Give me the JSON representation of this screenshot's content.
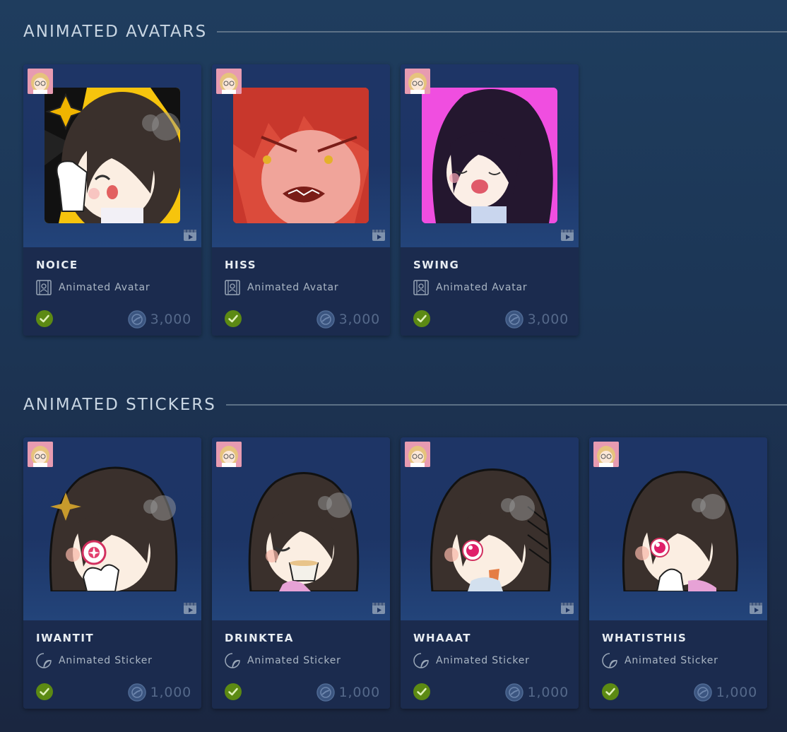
{
  "sections": [
    {
      "title": "ANIMATED AVATARS",
      "items": [
        {
          "name": "NOICE",
          "type": "Animated Avatar",
          "price": "3,000",
          "bg": "#f6c40d"
        },
        {
          "name": "HISS",
          "type": "Animated Avatar",
          "price": "3,000",
          "bg": "#d94a3a"
        },
        {
          "name": "SWING",
          "type": "Animated Avatar",
          "price": "3,000",
          "bg": "#f04ee0"
        }
      ]
    },
    {
      "title": "ANIMATED STICKERS",
      "items": [
        {
          "name": "IWANTIT",
          "type": "Animated Sticker",
          "price": "1,000"
        },
        {
          "name": "DRINKTEA",
          "type": "Animated Sticker",
          "price": "1,000"
        },
        {
          "name": "WHAAAT",
          "type": "Animated Sticker",
          "price": "1,000"
        },
        {
          "name": "WHATISTHIS",
          "type": "Animated Sticker",
          "price": "1,000"
        }
      ]
    }
  ],
  "colors": {
    "owned_check": "#5c8a13",
    "price_text": "#55698a",
    "card_bg": "#1f3563"
  },
  "icons": {
    "avatar_type": "avatar-film-icon",
    "sticker_type": "sticker-peel-icon",
    "video": "video-clip-icon",
    "owned": "check-circle-icon",
    "points": "steam-points-icon"
  }
}
